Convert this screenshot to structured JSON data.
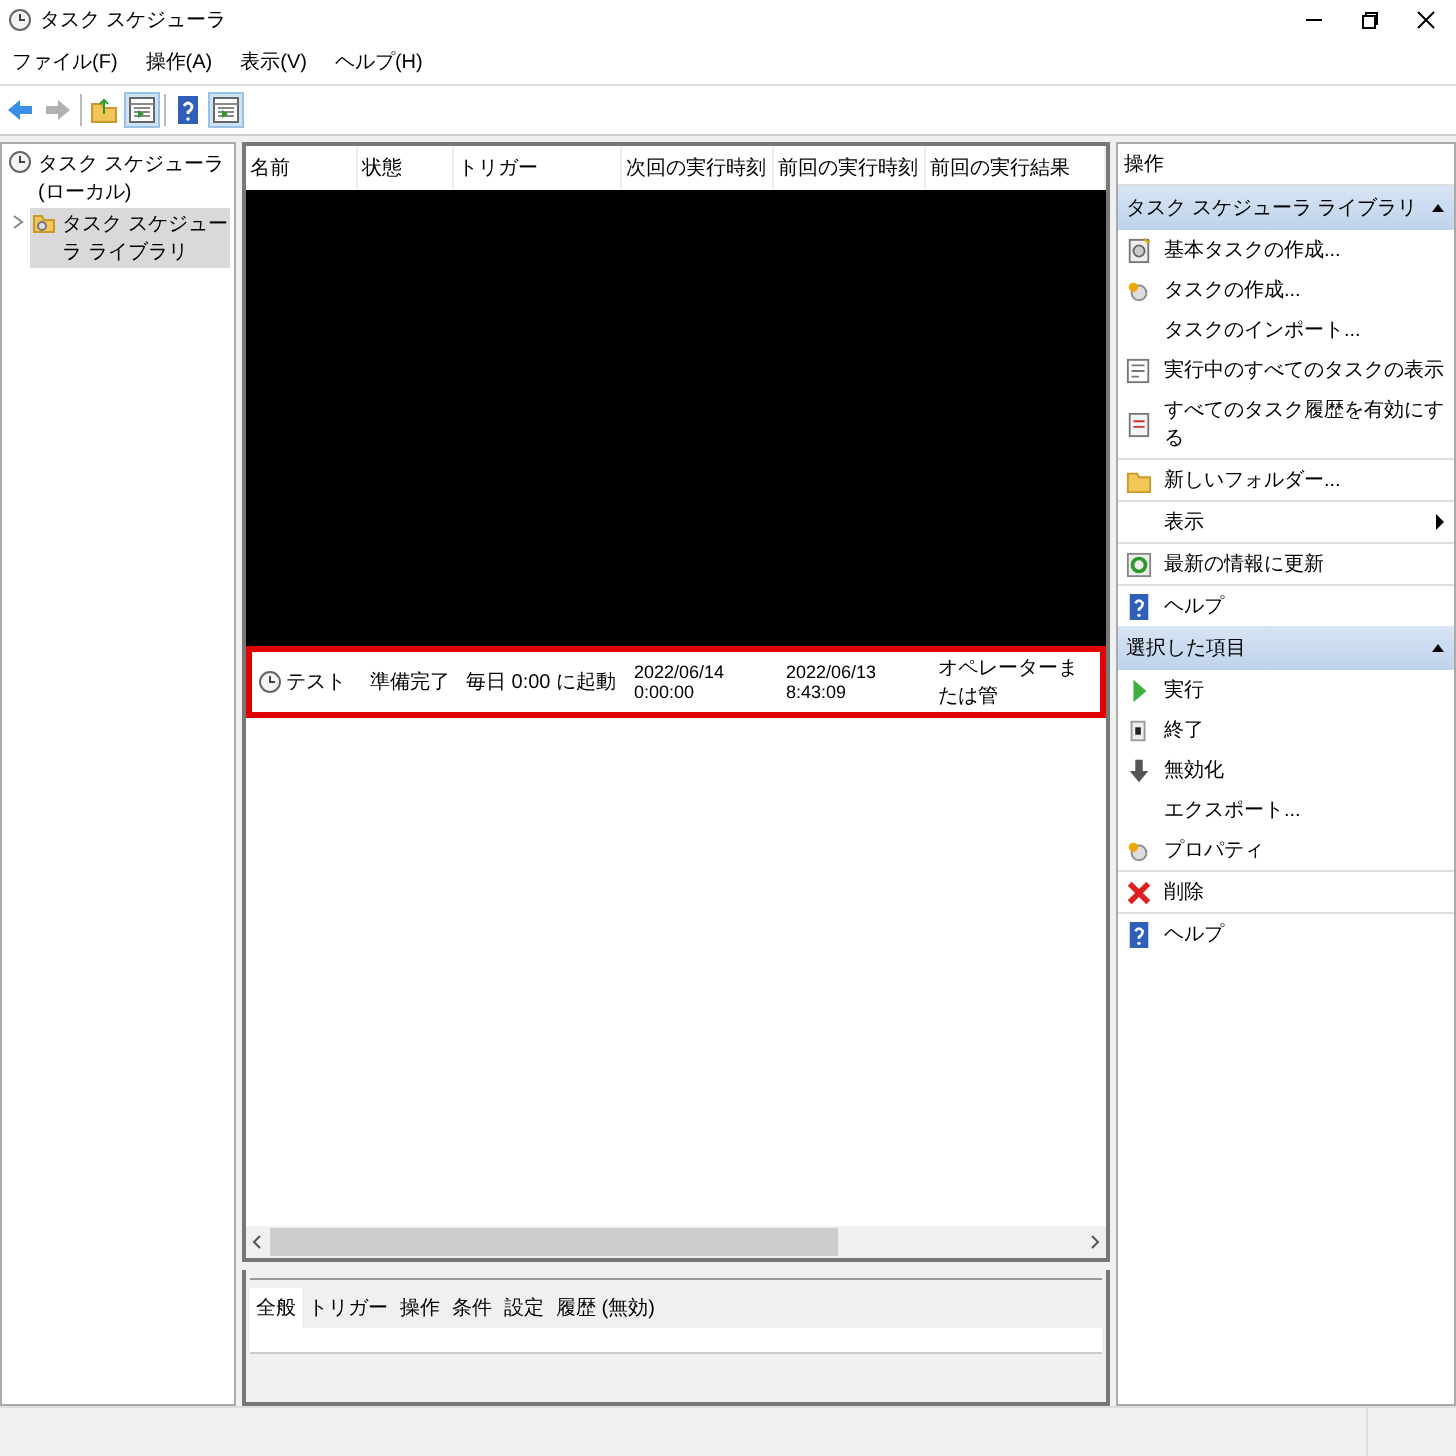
{
  "window": {
    "title": "タスク スケジューラ"
  },
  "menu": [
    "ファイル(F)",
    "操作(A)",
    "表示(V)",
    "ヘルプ(H)"
  ],
  "toolbar": [
    {
      "kind": "back",
      "disabled": false
    },
    {
      "kind": "forward",
      "disabled": true
    },
    {
      "kind": "folder-up",
      "disabled": false
    },
    {
      "kind": "panel",
      "disabled": false
    },
    {
      "kind": "help",
      "disabled": false
    },
    {
      "kind": "panel",
      "disabled": false
    }
  ],
  "tree": [
    {
      "label": "タスク スケジューラ (ローカル)",
      "selected": false,
      "children": [
        {
          "label": "タスク スケジューラ ライブラリ",
          "selected": true,
          "expanded": false
        }
      ]
    }
  ],
  "table": {
    "columns": [
      "名前",
      "状態",
      "トリガー",
      "次回の実行時刻",
      "前回の実行時刻",
      "前回の実行結果"
    ],
    "rows": [
      {
        "cells": [
          "テスト",
          "準備完了",
          "毎日 0:00 に起動",
          "2022/06/14 0:00:00",
          "2022/06/13 8:43:09",
          "オペレーターまたは管"
        ],
        "selected": true
      }
    ]
  },
  "detail_tabs": [
    {
      "label": "全般",
      "selected": true
    },
    {
      "label": "トリガー",
      "selected": false
    },
    {
      "label": "操作",
      "selected": false
    },
    {
      "label": "条件",
      "selected": false
    },
    {
      "label": "設定",
      "selected": false
    },
    {
      "label": "履歴 (無効)",
      "selected": false
    }
  ],
  "actions": {
    "title": "操作",
    "sections": [
      {
        "title": "タスク スケジューラ ライブラリ",
        "expanded": true,
        "items": [
          {
            "kind": "basic-task",
            "label": "基本タスクの作成...",
            "separator": false,
            "submenu": false
          },
          {
            "kind": "task",
            "label": "タスクの作成...",
            "separator": false,
            "submenu": false
          },
          {
            "kind": "none",
            "label": "タスクのインポート...",
            "separator": false,
            "submenu": false
          },
          {
            "kind": "list",
            "label": "実行中のすべてのタスクの表示",
            "separator": false,
            "submenu": false
          },
          {
            "kind": "history",
            "label": "すべてのタスク履歴を有効にする",
            "separator": true,
            "submenu": false
          },
          {
            "kind": "folder",
            "label": "新しいフォルダー...",
            "separator": true,
            "submenu": false
          },
          {
            "kind": "none",
            "label": "表示",
            "separator": true,
            "submenu": true
          },
          {
            "kind": "refresh",
            "label": "最新の情報に更新",
            "separator": true,
            "submenu": false
          },
          {
            "kind": "help",
            "label": "ヘルプ",
            "separator": false,
            "submenu": false
          }
        ]
      },
      {
        "title": "選択した項目",
        "expanded": true,
        "items": [
          {
            "kind": "run",
            "label": "実行",
            "separator": false,
            "submenu": false
          },
          {
            "kind": "stop",
            "label": "終了",
            "separator": false,
            "submenu": false
          },
          {
            "kind": "disable",
            "label": "無効化",
            "separator": false,
            "submenu": false
          },
          {
            "kind": "none",
            "label": "エクスポート...",
            "separator": false,
            "submenu": false
          },
          {
            "kind": "task",
            "label": "プロパティ",
            "separator": true,
            "submenu": false
          },
          {
            "kind": "delete",
            "label": "削除",
            "separator": true,
            "submenu": false
          },
          {
            "kind": "help",
            "label": "ヘルプ",
            "separator": false,
            "submenu": false
          }
        ]
      }
    ]
  }
}
